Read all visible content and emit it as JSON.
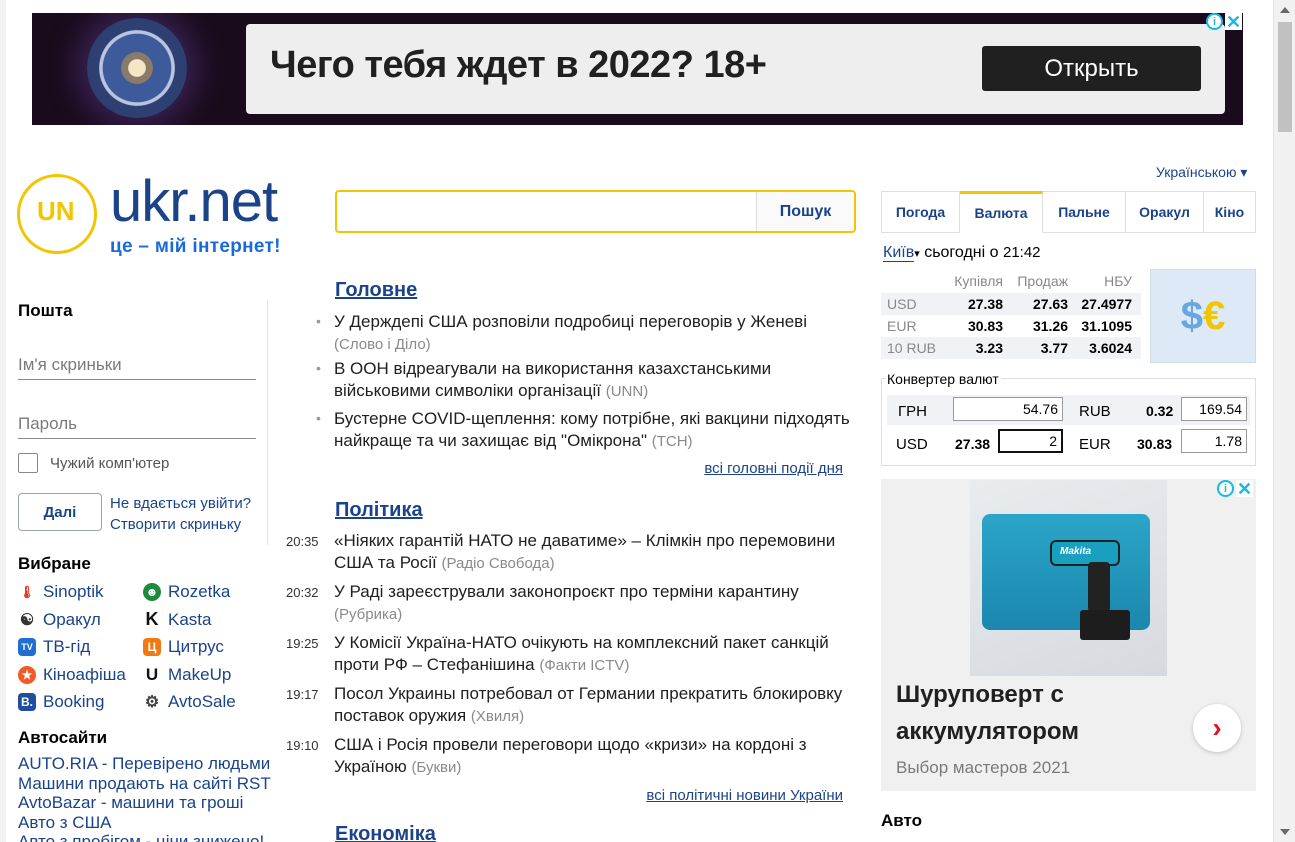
{
  "ad_top": {
    "headline": "Чего тебя ждет в 2022? 18+",
    "button": "Открыть",
    "info_icon": "i",
    "close_icon": "✕"
  },
  "header": {
    "language": "Українською ▾",
    "logo_text": "ukr.net",
    "logo_mark": "UN",
    "slogan": "це – мій інтернет!",
    "search_button": "Пошук"
  },
  "mail": {
    "title": "Пошта",
    "login_placeholder": "Ім'я скриньки",
    "password_placeholder": "Пароль",
    "foreign_pc": "Чужий комп'ютер",
    "next_button": "Далі",
    "cant_login": "Не вдається увійти?",
    "create_box": "Створити скриньку"
  },
  "favorites": {
    "title": "Вибране",
    "items": [
      {
        "label": "Sinoptik",
        "icon": "thermometer-icon",
        "glyph": "🌡",
        "color": "#ffffff"
      },
      {
        "label": "Rozetka",
        "icon": "rozetka-icon",
        "glyph": "☻",
        "color": "#1f8a3c"
      },
      {
        "label": "Оракул",
        "icon": "yin-yang-icon",
        "glyph": "☯",
        "color": "#ffffff"
      },
      {
        "label": "Kasta",
        "icon": "kasta-icon",
        "glyph": "K",
        "color": "#ffffff"
      },
      {
        "label": "ТВ-гід",
        "icon": "tv-icon",
        "glyph": "TV",
        "color": "#1f6fd1"
      },
      {
        "label": "Цитрус",
        "icon": "citrus-icon",
        "glyph": "Ц",
        "color": "#f07a11"
      },
      {
        "label": "Кіноафіша",
        "icon": "star-icon",
        "glyph": "★",
        "color": "#f05a28"
      },
      {
        "label": "MakeUp",
        "icon": "makeup-icon",
        "glyph": "U",
        "color": "#ffffff"
      },
      {
        "label": "Booking",
        "icon": "booking-icon",
        "glyph": "B.",
        "color": "#1f4e9e"
      },
      {
        "label": "AvtoSale",
        "icon": "avtosale-icon",
        "glyph": "⚙",
        "color": "#ffffff"
      }
    ]
  },
  "autosites": {
    "title": "Автосайти",
    "links": [
      "AUTO.RIA - Перевірено людьми",
      "Машини продають на сайті RST",
      "AvtoBazar - машини та гроші",
      "Авто з США",
      "Авто з пробігом - ціни знижено!"
    ]
  },
  "news": {
    "main": {
      "title": "Головне",
      "items": [
        {
          "text": "У Держдепі США розповіли подробиці переговорів у Женеві",
          "source": "(Слово і Діло)"
        },
        {
          "text": "В ООН відреагували на використання казахстанськими військовими символіки організації",
          "source": "(UNN)"
        },
        {
          "text": "Бустерне COVID-щеплення: кому потрібне, які вакцини підходять найкраще та чи захищає від \"Омікрона\"",
          "source": "(ТСН)"
        }
      ],
      "more": "всі головні події дня"
    },
    "politics": {
      "title": "Політика",
      "items": [
        {
          "time": "20:35",
          "text": "«Ніяких гарантій НАТО не даватиме» – Клімкін про перемовини США та Росії",
          "source": "(Радіо Свобода)"
        },
        {
          "time": "20:32",
          "text": "У Раді зареєстрували законопроєкт про терміни карантину",
          "source": "(Рубрика)"
        },
        {
          "time": "19:25",
          "text": "У Комісії Україна-НАТО очікують на комплексний пакет санкцій проти РФ – Стефанішина",
          "source": "(Факти ICTV)"
        },
        {
          "time": "19:17",
          "text": "Посол Украины потребовал от Германии прекратить блокировку поставок оружия",
          "source": "(Хвиля)"
        },
        {
          "time": "19:10",
          "text": "США і Росія провели переговори щодо «кризи» на кордоні з Україною",
          "source": "(Букви)"
        }
      ],
      "more": "всі політичні новини України"
    },
    "economy": {
      "title": "Економіка"
    }
  },
  "widgets": {
    "tabs": [
      "Погода",
      "Валюта",
      "Пальне",
      "Оракул",
      "Кіно"
    ],
    "active_tab": "Валюта",
    "city": "Київ",
    "city_arrow": "▾",
    "today_prefix": "сьогодні о",
    "time": "21:42",
    "rates_head": [
      "",
      "Купівля",
      "Продаж",
      "НБУ"
    ],
    "rates": [
      [
        "USD",
        "27.38",
        "27.63",
        "27.4977"
      ],
      [
        "EUR",
        "30.83",
        "31.26",
        "31.1095"
      ],
      [
        "10 RUB",
        "3.23",
        "3.77",
        "3.6024"
      ]
    ],
    "converter": {
      "title": "Конвертер валют",
      "uah_label": "ГРН",
      "uah_value": "54.76",
      "rub_label": "RUB",
      "rub_rate": "0.32",
      "rub_value": "169.54",
      "usd_label": "USD",
      "usd_rate": "27.38",
      "usd_value": "2",
      "eur_label": "EUR",
      "eur_rate": "30.83",
      "eur_value": "1.78"
    }
  },
  "ad_side": {
    "title": "Шуруповерт с аккумулятором",
    "subtitle": "Выбор мастеров 2021",
    "brand": "Makita",
    "arrow": "›"
  },
  "auto_right": {
    "title": "Авто"
  }
}
